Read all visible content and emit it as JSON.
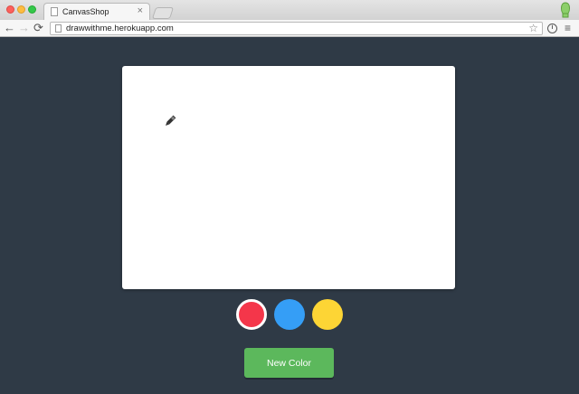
{
  "browser": {
    "tab": {
      "title": "CanvasShop",
      "close": "×"
    },
    "nav": {
      "back": "←",
      "forward": "→",
      "reload": "⟳"
    },
    "url": "drawwithme.herokuapp.com",
    "bookmark_star": "☆",
    "menu": "≡",
    "extension_label": "i"
  },
  "page": {
    "swatches": [
      {
        "name": "red",
        "color": "#f4364a",
        "selected": true
      },
      {
        "name": "blue",
        "color": "#359ef6",
        "selected": false
      },
      {
        "name": "yellow",
        "color": "#fdd535",
        "selected": false
      }
    ],
    "new_color_button": {
      "label": "New Color",
      "color": "#5cb85c"
    }
  }
}
